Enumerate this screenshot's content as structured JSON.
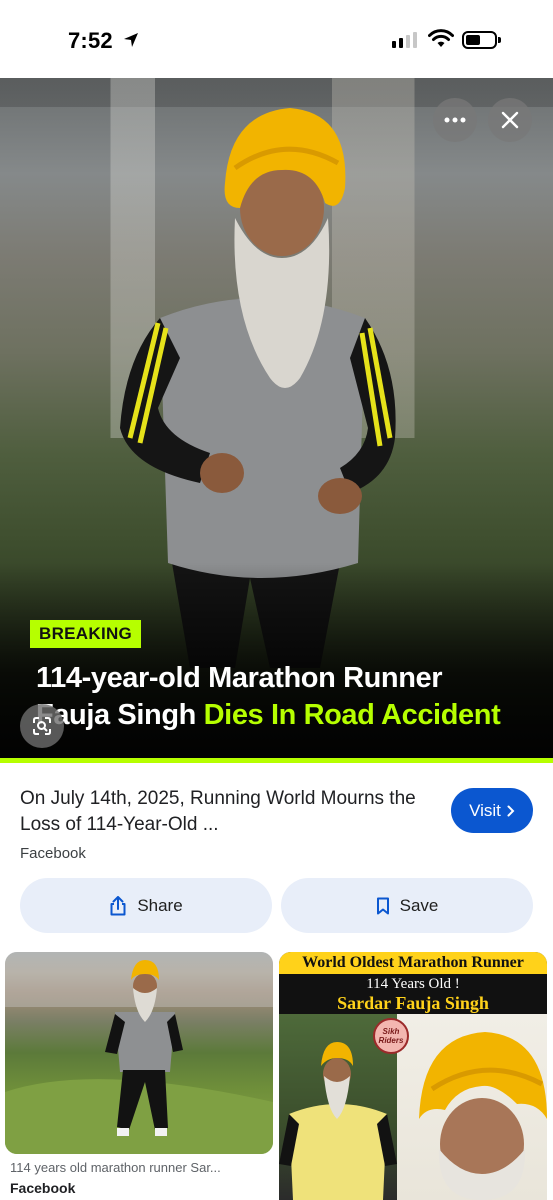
{
  "status_bar": {
    "time": "7:52"
  },
  "hero": {
    "badge": "BREAKING",
    "headline_line1": "114-year-old Marathon Runner",
    "headline_line2_white": "Fauja Singh",
    "headline_line2_accent": "Dies In Road Accident",
    "accent_color": "#b6ff00",
    "more_icon": "more-horizontal-icon",
    "close_icon": "close-icon",
    "lens_icon": "lens-search-icon"
  },
  "result": {
    "title": "On July 14th, 2025, Running World Mourns the Loss of 114-Year-Old ...",
    "source": "Facebook",
    "visit_label": "Visit",
    "visit_color": "#0b57d0"
  },
  "actions": {
    "share_label": "Share",
    "save_label": "Save"
  },
  "related": [
    {
      "caption": "114 years old marathon runner Sar...",
      "source": "Facebook"
    },
    {
      "title": "World Oldest Marathon Runner",
      "subtitle": "114 Years Old !",
      "name": "Sardar Fauja Singh",
      "logo_line1": "Sikh",
      "logo_line2": "Riders"
    }
  ]
}
